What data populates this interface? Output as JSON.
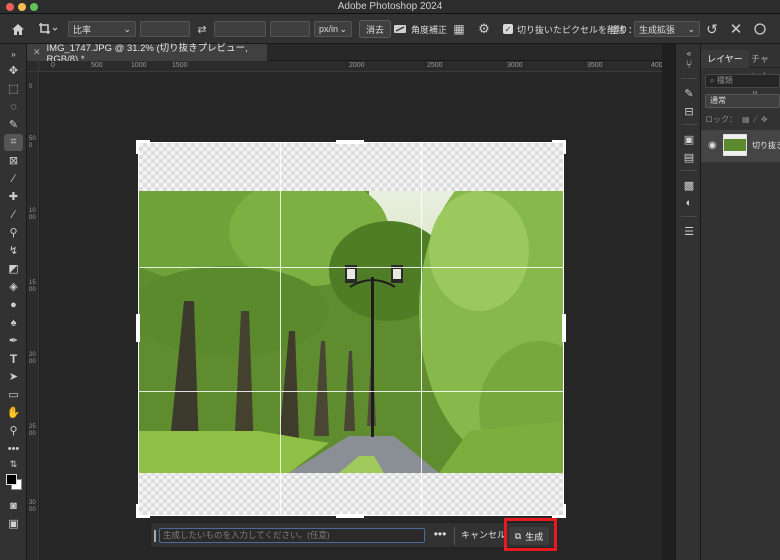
{
  "window": {
    "title": "Adobe Photoshop 2024"
  },
  "options_bar": {
    "ratio_select": "比率",
    "unit_select": "px/in",
    "clear_label": "消去",
    "straighten_label": "角度補正",
    "delete_cropped_label": "切り抜いたピクセルを削除",
    "delete_cropped_checked": true,
    "fill_label": "塗り：",
    "fill_select": "生成拡張"
  },
  "document_tab": {
    "title": "IMG_1747.JPG @ 31.2% (切り抜きプレビュー, RGB/8) *"
  },
  "rulers": {
    "horizontal": [
      "0",
      "500",
      "1000",
      "1500",
      "2000",
      "2500",
      "3000",
      "3500",
      "4000"
    ],
    "vertical": [
      "0",
      "500",
      "1000",
      "1500",
      "2000",
      "2500",
      "3000"
    ]
  },
  "generative_bar": {
    "placeholder": "生成したいものを入力してください。(任意)",
    "more_label": "•••",
    "cancel_label": "キャンセル",
    "generate_label": "生成"
  },
  "layers_panel": {
    "tabs": [
      "レイヤー",
      "チャンネル"
    ],
    "search_placeholder": "種類",
    "blend_mode": "通常",
    "lock_label": "ロック：",
    "layer_name": "切り抜き"
  },
  "colors": {
    "highlight": "#e8191f",
    "panel_bg": "#323232",
    "canvas_bg": "#262626"
  }
}
